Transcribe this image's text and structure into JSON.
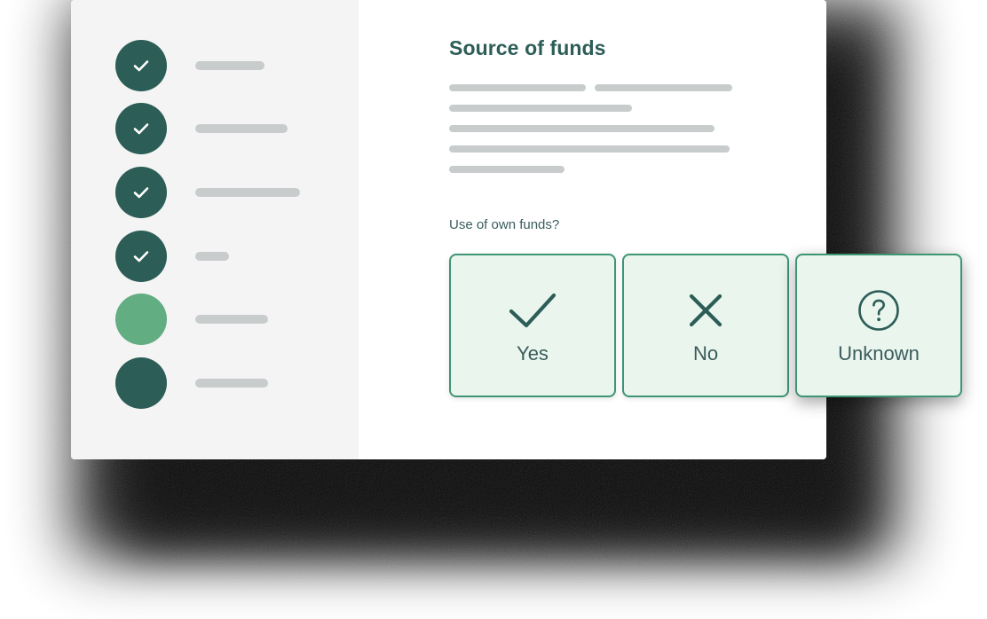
{
  "card": {
    "background": "#ffffff",
    "sidebar_background": "#f3f4f3"
  },
  "colors": {
    "teal_dark": "#2c5d57",
    "teal_text": "#3b5c5c",
    "green_light": "#62ad82",
    "green_border": "#3e9574",
    "green_fill": "#eaf5ee",
    "skeleton_grey": "#c9cccd",
    "shadow": "#000000"
  },
  "sidebar": {
    "steps": [
      {
        "state": "complete",
        "icon": "check-icon",
        "dot_color": "#2c5d57",
        "label_width": 78
      },
      {
        "state": "complete",
        "icon": "check-icon",
        "dot_color": "#2c5d57",
        "label_width": 104
      },
      {
        "state": "complete",
        "icon": "check-icon",
        "dot_color": "#2c5d57",
        "label_width": 118
      },
      {
        "state": "complete",
        "icon": "check-icon",
        "dot_color": "#2c5d57",
        "label_width": 38
      },
      {
        "state": "current",
        "icon": "",
        "dot_color": "#62ad82",
        "label_width": 82
      },
      {
        "state": "upcoming",
        "icon": "",
        "dot_color": "#2c5d57",
        "label_width": 82
      }
    ]
  },
  "main": {
    "title": "Source of funds",
    "skeleton_lines": [
      {
        "segments": [
          154,
          155
        ]
      },
      {
        "segments": [
          206
        ]
      },
      {
        "segments": [
          299
        ]
      },
      {
        "segments": [
          316
        ]
      },
      {
        "segments": [
          130
        ]
      }
    ],
    "question": "Use of own funds?",
    "options": [
      {
        "id": "yes",
        "label": "Yes",
        "icon": "check-icon"
      },
      {
        "id": "no",
        "label": "No",
        "icon": "close-icon"
      },
      {
        "id": "unknown",
        "label": "Unknown",
        "icon": "question-circle-icon"
      }
    ]
  }
}
